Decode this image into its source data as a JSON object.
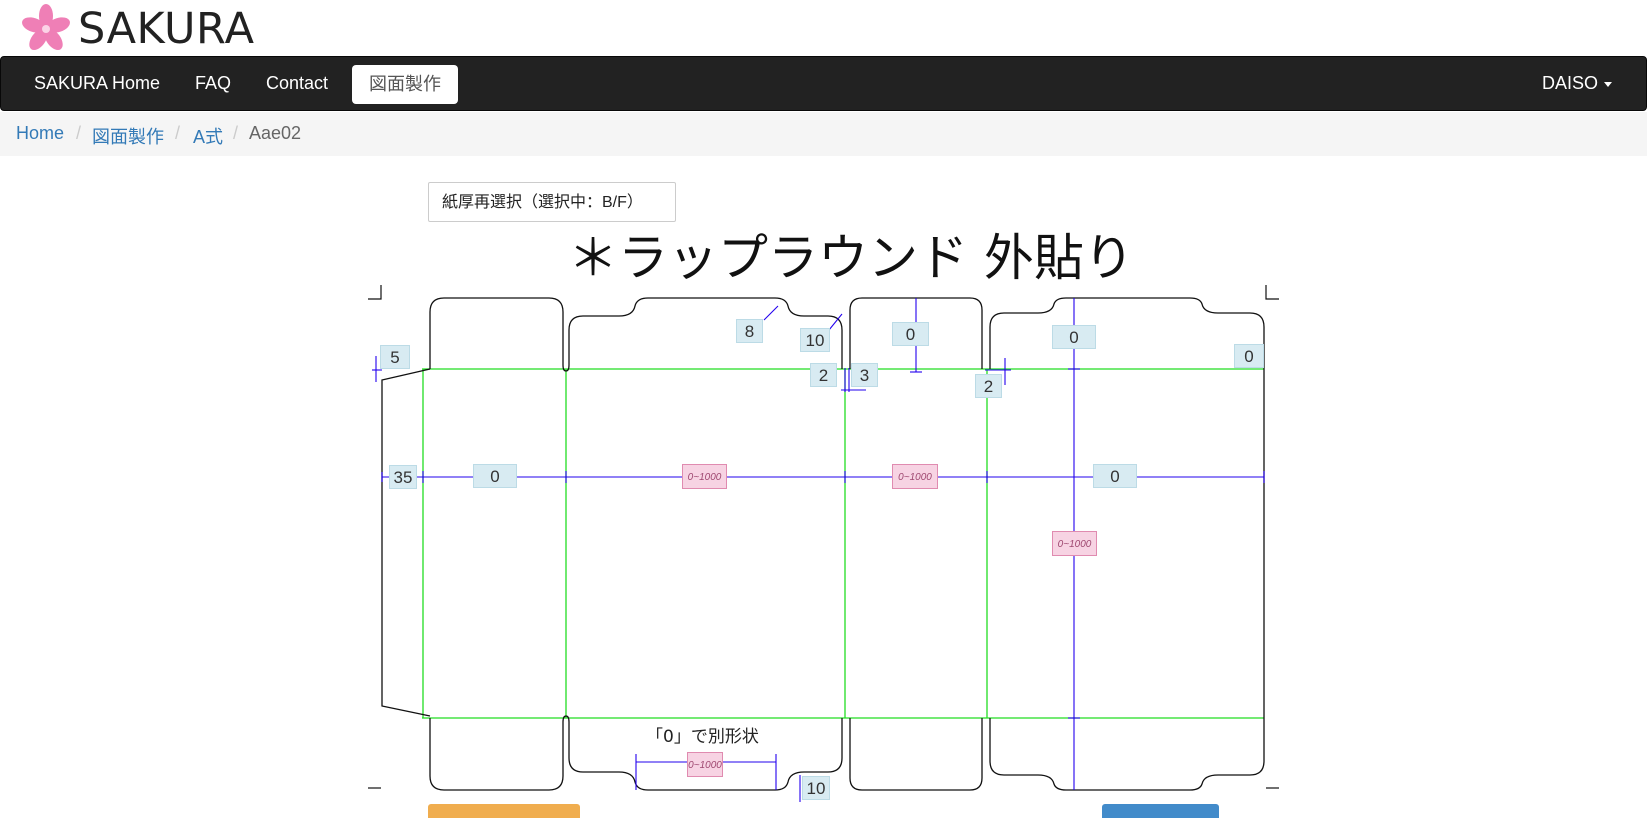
{
  "brand": {
    "name": "SAKURA"
  },
  "nav": {
    "items": [
      "SAKURA Home",
      "FAQ",
      "Contact",
      "図面製作"
    ],
    "user": "DAISO"
  },
  "breadcrumb": {
    "items": [
      "Home",
      "図面製作",
      "A式"
    ],
    "current": "Aae02"
  },
  "paper_button": "紙厚再選択（選択中：B/F）",
  "title": "＊ラップラウンド 外貼り",
  "dimensions": {
    "top_a": "8",
    "top_b": "10",
    "top_c": "0",
    "top_d": "0",
    "top_e": "0",
    "left_flap": "5",
    "gap_a": "2",
    "gap_b": "3",
    "gap_c": "2",
    "glue_width": "35",
    "panel_1": "0",
    "panel_4": "0",
    "bottom": "10"
  },
  "range_placeholder": "0~1000",
  "note": "「0」で別形状",
  "colors": {
    "fold_line": "#22dd22",
    "dim_line": "#2200ee",
    "cut_line": "#111111"
  }
}
